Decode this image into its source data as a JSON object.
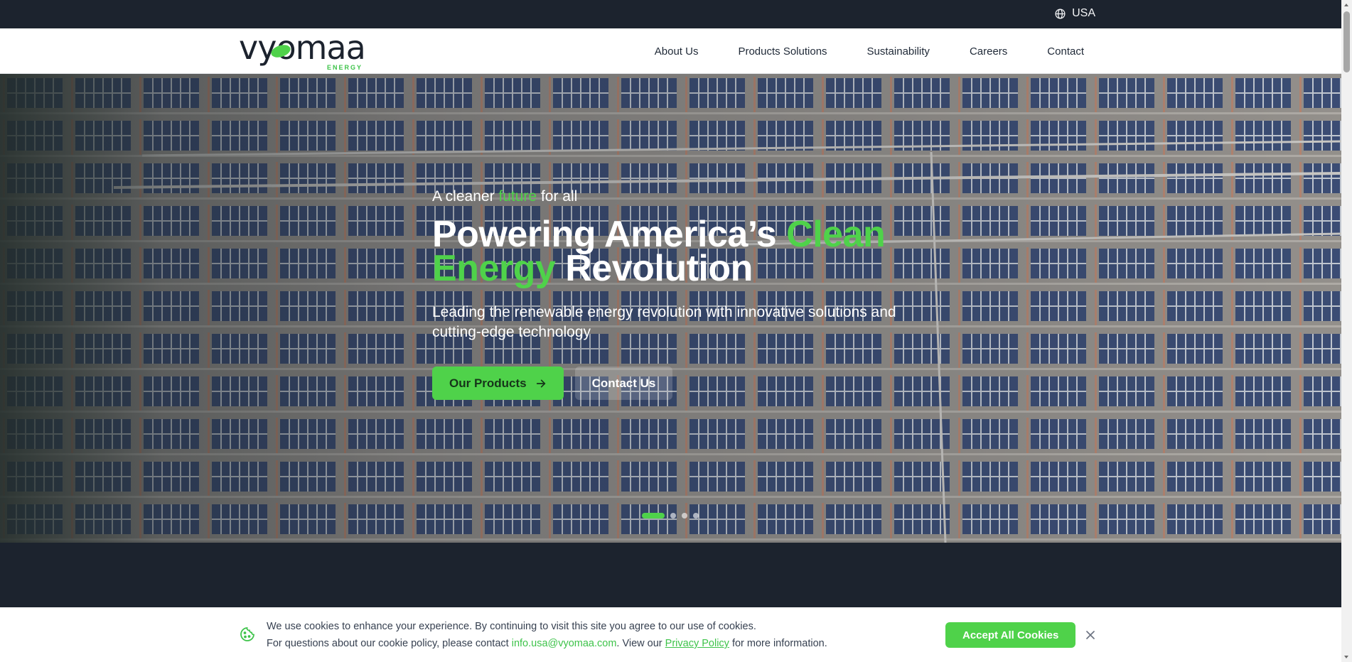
{
  "topbar": {
    "region_label": "USA",
    "region_icon": "globe-icon"
  },
  "brand": {
    "wordmark": "vyomaa",
    "tagline": "ENERGY",
    "accent": "#4fd24a",
    "dark": "#1c232e"
  },
  "nav": {
    "items": [
      {
        "label": "About Us"
      },
      {
        "label": "Products Solutions"
      },
      {
        "label": "Sustainability"
      },
      {
        "label": "Careers"
      },
      {
        "label": "Contact"
      }
    ]
  },
  "hero": {
    "eyebrow_prefix": "A cleaner ",
    "eyebrow_highlight": "future",
    "eyebrow_suffix": " for all",
    "headline_part1": "Powering America’s ",
    "headline_highlight": "Clean Energy",
    "headline_part2": " Revolution",
    "subtitle": "Leading the renewable energy revolution with innovative solutions and cutting-edge technology",
    "primary_button": "Our Products",
    "primary_button_icon": "arrow-right-icon",
    "secondary_button": "Contact Us",
    "slides_total": 4,
    "active_slide": 1
  },
  "cookie": {
    "line1": "We use cookies to enhance your experience. By continuing to visit this site you agree to our use of cookies.",
    "line2_prefix": "For questions about our cookie policy, please contact ",
    "email": "info.usa@vyomaa.com",
    "line2_middle": ". View our ",
    "privacy_link": "Privacy Policy",
    "line2_suffix": " for more information.",
    "accept_button": "Accept All Cookies",
    "icon": "cookie-icon",
    "close_icon": "close-icon"
  }
}
